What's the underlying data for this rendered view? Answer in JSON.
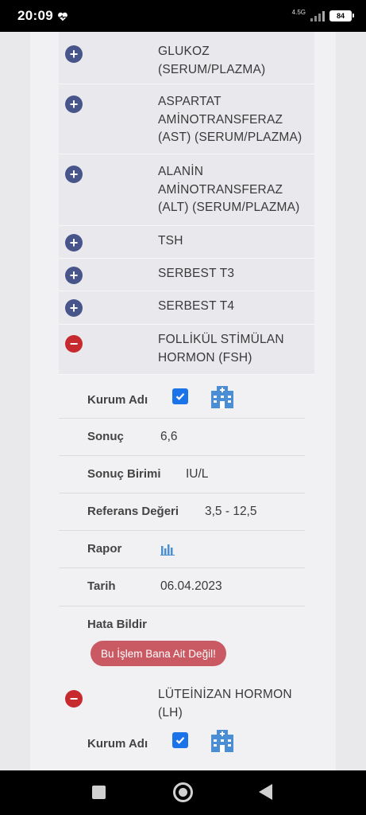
{
  "status_bar": {
    "time": "20:09",
    "network": "4.5G",
    "battery": "84"
  },
  "tests": [
    {
      "label": "GLUKOZ\n(SERUM/PLAZMA)",
      "state": "collapsed"
    },
    {
      "label": "ASPARTAT\nAMİNOTRANSFERAZ\n(AST) (SERUM/PLAZMA)",
      "state": "collapsed"
    },
    {
      "label": "ALANİN\nAMİNOTRANSFERAZ\n(ALT) (SERUM/PLAZMA)",
      "state": "collapsed"
    },
    {
      "label": "TSH",
      "state": "collapsed"
    },
    {
      "label": "SERBEST T3",
      "state": "collapsed"
    },
    {
      "label": "SERBEST T4",
      "state": "collapsed"
    },
    {
      "label": "FOLLİKÜL STİMÜLAN\nHORMON (FSH)",
      "state": "expanded"
    },
    {
      "label": "LÜTEİNİZAN HORMON\n(LH)",
      "state": "expanded"
    }
  ],
  "toggle_symbols": {
    "collapsed": "+",
    "expanded": "−"
  },
  "fsh_details": {
    "institution_label": "Kurum Adı",
    "institution_checked": true,
    "result_label": "Sonuç",
    "result_value": "6,6",
    "unit_label": "Sonuç Birimi",
    "unit_value": "IU/L",
    "reference_label": "Referans Değeri",
    "reference_value": "3,5 - 12,5",
    "report_label": "Rapor",
    "date_label": "Tarih",
    "date_value": "06.04.2023",
    "error_label": "Hata Bildir",
    "error_button": "Bu İşlem Bana Ait Değil!"
  },
  "lh_details": {
    "institution_label": "Kurum Adı",
    "institution_checked": true
  },
  "colors": {
    "plus_toggle": "#48558a",
    "minus_toggle": "#c62a2f",
    "checkbox": "#1a73e8",
    "error_button": "#c95a63",
    "building_icon": "#4a8fd6"
  },
  "icons": {
    "institution": "hospital-building-icon",
    "report": "bar-chart-icon",
    "status_heart": "heart-pulse-icon"
  }
}
